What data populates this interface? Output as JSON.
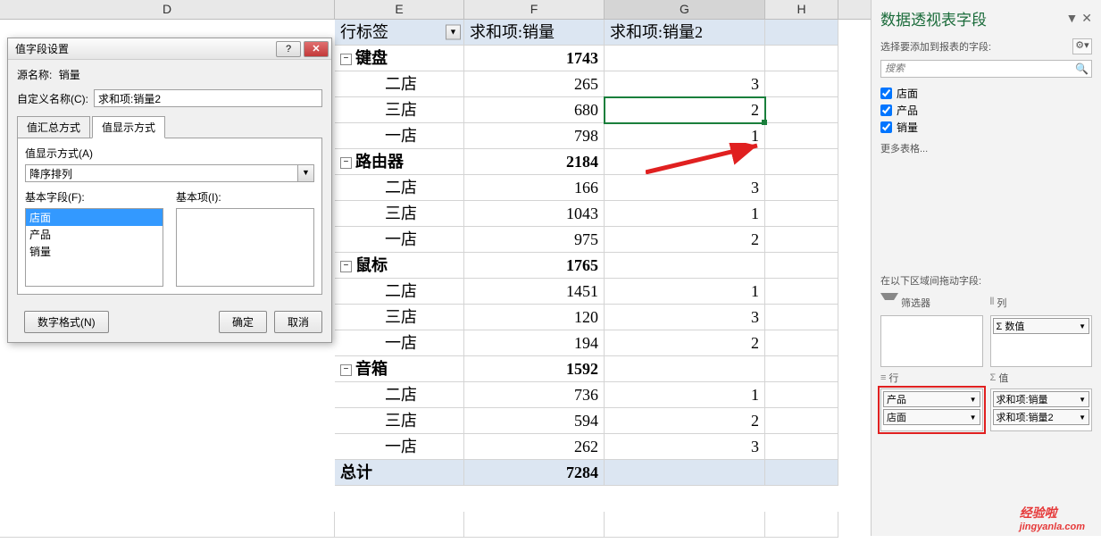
{
  "columns": {
    "d": "D",
    "e": "E",
    "f": "F",
    "g": "G",
    "h": "H"
  },
  "pivot": {
    "header": {
      "e": "行标签",
      "f": "求和项:销量",
      "g": "求和项:销量2"
    },
    "groups": [
      {
        "name": "键盘",
        "sum": 1743,
        "rows": [
          {
            "label": "二店",
            "f": 265,
            "g": 3
          },
          {
            "label": "三店",
            "f": 680,
            "g": 2
          },
          {
            "label": "一店",
            "f": 798,
            "g": 1
          }
        ]
      },
      {
        "name": "路由器",
        "sum": 2184,
        "rows": [
          {
            "label": "二店",
            "f": 166,
            "g": 3
          },
          {
            "label": "三店",
            "f": 1043,
            "g": 1
          },
          {
            "label": "一店",
            "f": 975,
            "g": 2
          }
        ]
      },
      {
        "name": "鼠标",
        "sum": 1765,
        "rows": [
          {
            "label": "二店",
            "f": 1451,
            "g": 1
          },
          {
            "label": "三店",
            "f": 120,
            "g": 3
          },
          {
            "label": "一店",
            "f": 194,
            "g": 2
          }
        ]
      },
      {
        "name": "音箱",
        "sum": 1592,
        "rows": [
          {
            "label": "二店",
            "f": 736,
            "g": 1
          },
          {
            "label": "三店",
            "f": 594,
            "g": 2
          },
          {
            "label": "一店",
            "f": 262,
            "g": 3
          }
        ]
      }
    ],
    "total": {
      "label": "总计",
      "sum": 7284
    }
  },
  "dialog": {
    "title": "值字段设置",
    "src_label": "源名称:",
    "src_value": "销量",
    "custom_label": "自定义名称(C):",
    "custom_value": "求和项:销量2",
    "tab1": "值汇总方式",
    "tab2": "值显示方式",
    "display_label": "值显示方式(A)",
    "display_value": "降序排列",
    "basefield_label": "基本字段(F):",
    "baseitem_label": "基本项(I):",
    "basefields": [
      "店面",
      "产品",
      "销量"
    ],
    "number_format": "数字格式(N)",
    "ok": "确定",
    "cancel": "取消"
  },
  "fields": {
    "title": "数据透视表字段",
    "subtitle": "选择要添加到报表的字段:",
    "search_placeholder": "搜索",
    "items": [
      "店面",
      "产品",
      "销量"
    ],
    "more": "更多表格...",
    "drag_label": "在以下区域间拖动字段:",
    "filters": "筛选器",
    "columns": "列",
    "rows": "行",
    "values": "值",
    "col_pills": [
      "Σ 数值"
    ],
    "row_pills": [
      "产品",
      "店面"
    ],
    "val_pills": [
      "求和项:销量",
      "求和项:销量2"
    ]
  },
  "watermark": {
    "cn": "经验啦",
    "en": "jingyanla.com"
  }
}
